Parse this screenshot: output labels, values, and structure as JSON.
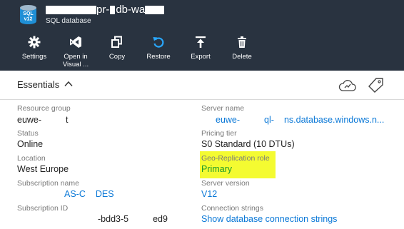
{
  "header": {
    "icon_text_top": "SQL",
    "icon_text_bottom": "v12",
    "title_fragment": "pr-",
    "title_fragment_2": "db-wa",
    "subtitle": "SQL database"
  },
  "commands": [
    {
      "label": "Settings",
      "icon": "gear-icon"
    },
    {
      "label": "Open in",
      "label2": "Visual ...",
      "icon": "visual-studio-icon"
    },
    {
      "label": "Copy",
      "icon": "copy-icon"
    },
    {
      "label": "Restore",
      "icon": "restore-icon"
    },
    {
      "label": "Export",
      "icon": "export-icon"
    },
    {
      "label": "Delete",
      "icon": "trash-icon"
    }
  ],
  "essentials": {
    "title": "Essentials",
    "left": {
      "resource_group": {
        "label": "Resource group",
        "value_a": "euwe-",
        "value_b": "t"
      },
      "status": {
        "label": "Status",
        "value": "Online"
      },
      "location": {
        "label": "Location",
        "value": "West Europe"
      },
      "subscription_name": {
        "label": "Subscription name",
        "value_a": "AS-C",
        "value_b": "DES"
      },
      "subscription_id": {
        "label": "Subscription ID",
        "value_a": "-bdd3-5",
        "value_b": "ed9"
      }
    },
    "right": {
      "server_name": {
        "label": "Server name",
        "value_a": "euwe-",
        "value_b": "ql-",
        "value_c": "ns.database.windows.n..."
      },
      "pricing_tier": {
        "label": "Pricing tier",
        "value": "S0 Standard (10 DTUs)"
      },
      "geo_role": {
        "label": "Geo-Replication role",
        "value": "Primary"
      },
      "server_version": {
        "label": "Server version",
        "value": "V12"
      },
      "connection_strings": {
        "label": "Connection strings",
        "value": "Show database connection strings"
      }
    }
  },
  "colors": {
    "header_bg": "#293340",
    "link": "#0a78d7",
    "highlight": "#f4fb31",
    "primary_green": "#1b9a2a"
  }
}
